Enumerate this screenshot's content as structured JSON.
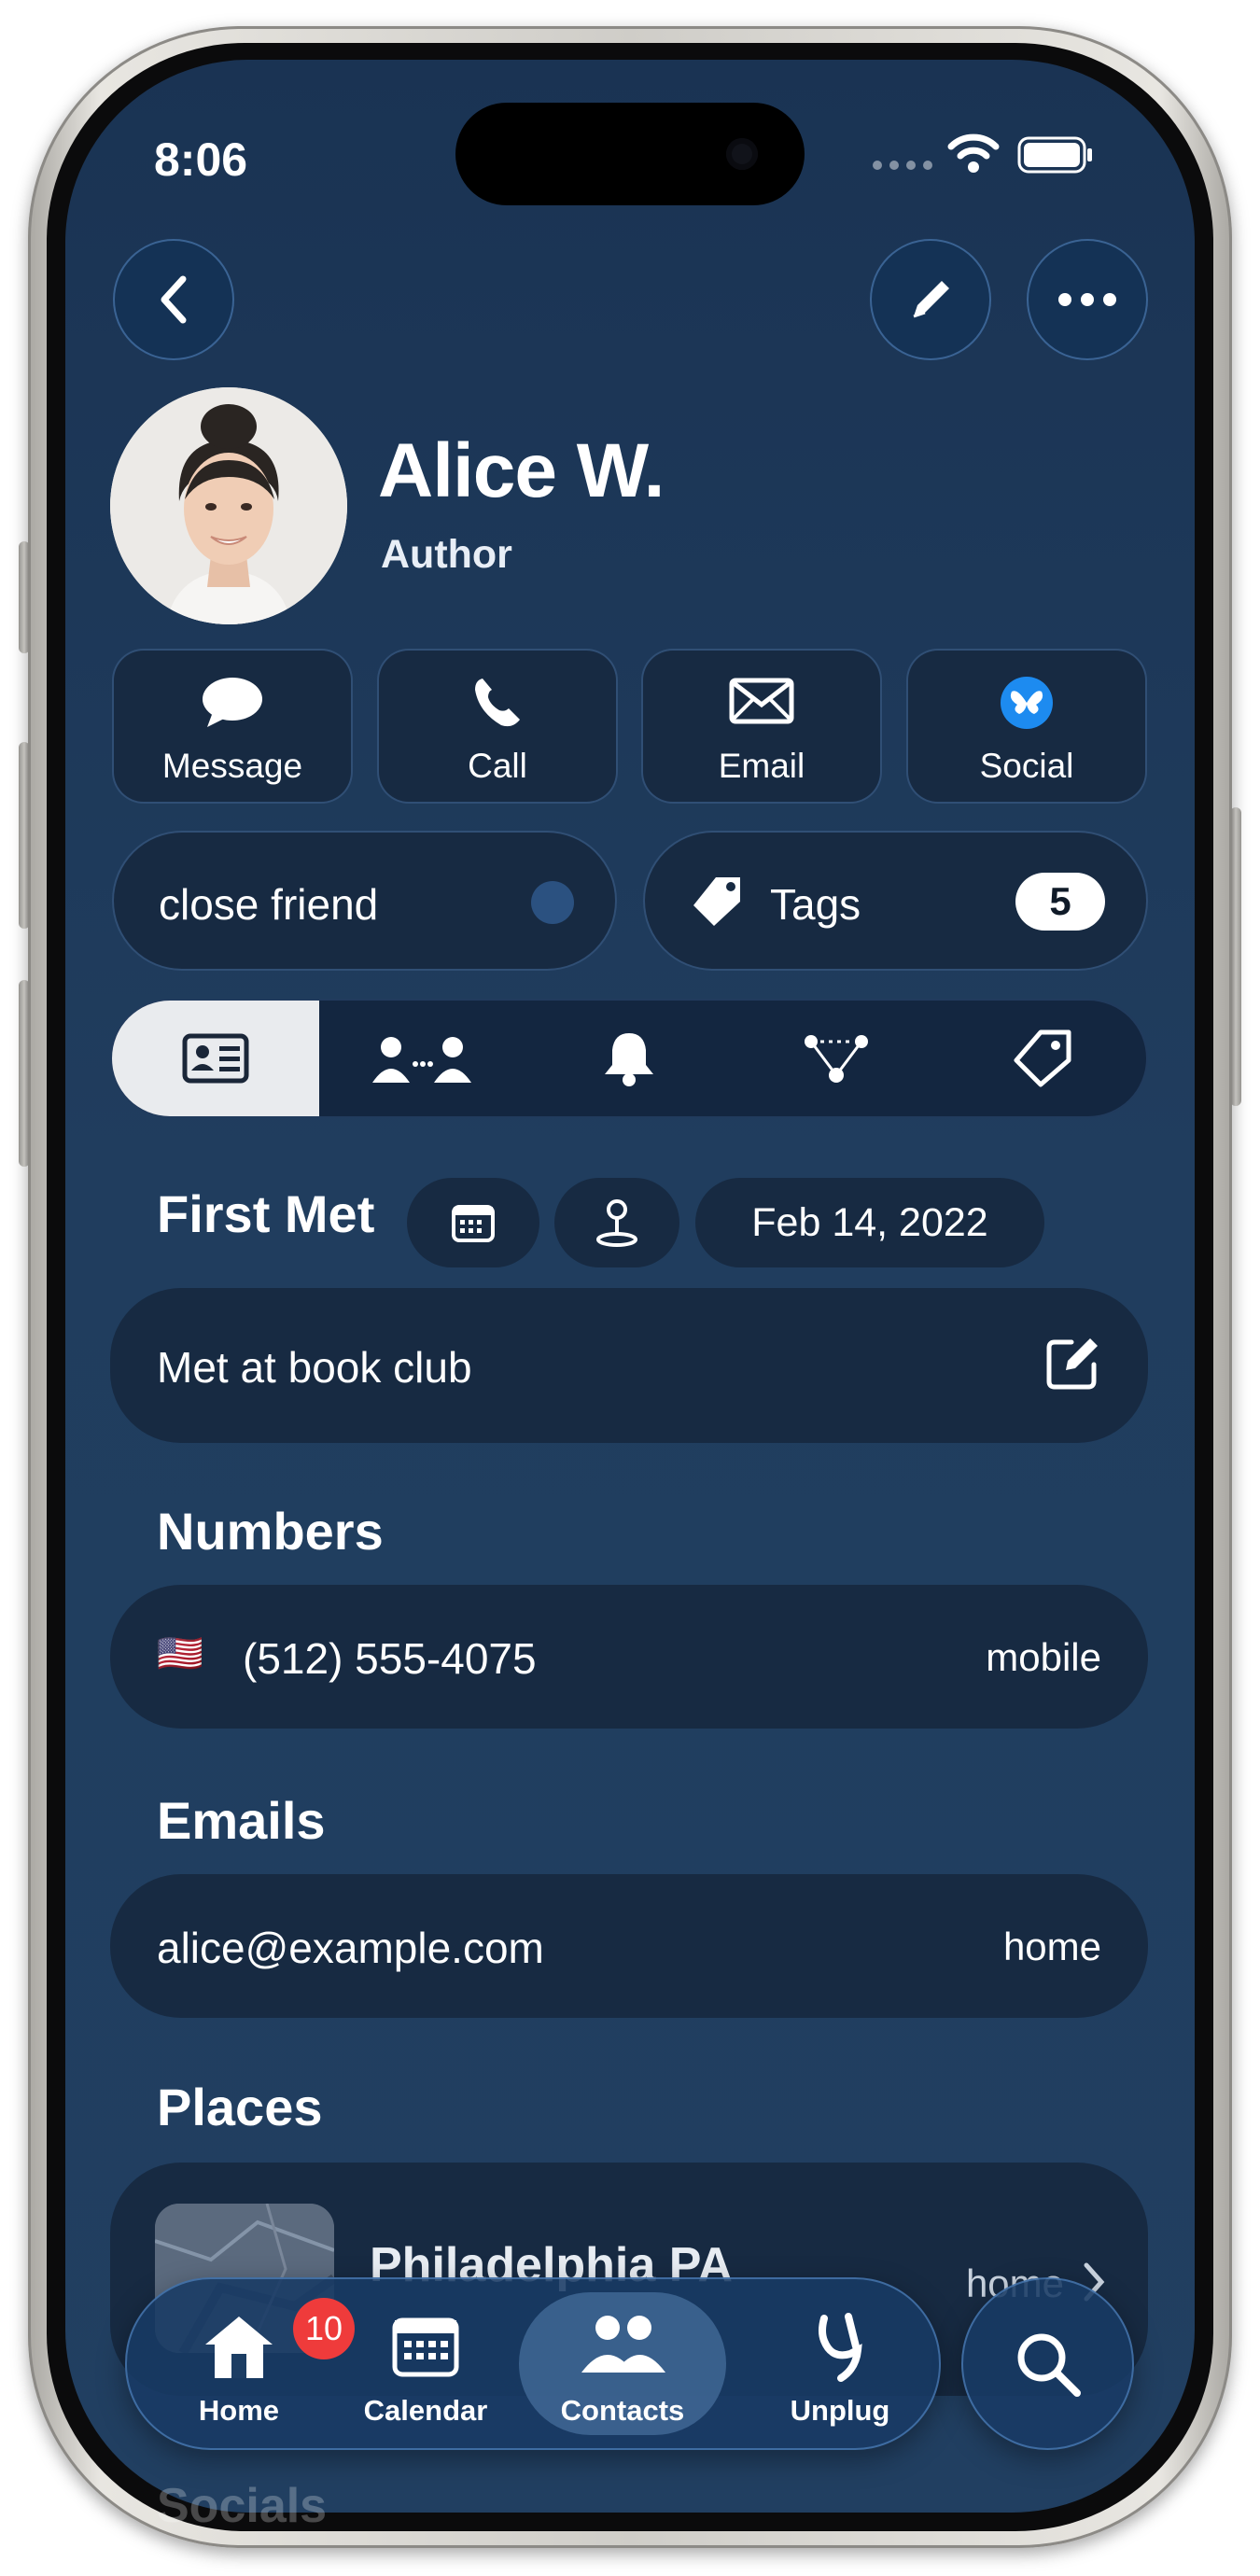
{
  "status_bar": {
    "time": "8:06",
    "wifi_icon": "wifi-icon",
    "battery_icon": "battery-icon"
  },
  "nav": {
    "back_icon": "chevron-left-icon",
    "edit_icon": "pencil-icon",
    "more_icon": "ellipsis-icon"
  },
  "profile": {
    "name": "Alice W.",
    "role": "Author"
  },
  "actions": [
    {
      "label": "Message",
      "icon": "message-bubble-icon"
    },
    {
      "label": "Call",
      "icon": "phone-icon"
    },
    {
      "label": "Email",
      "icon": "envelope-icon"
    },
    {
      "label": "Social",
      "icon": "butterfly-icon"
    }
  ],
  "group": {
    "label": "close friend",
    "dot_color": "#2b5180"
  },
  "tags": {
    "label": "Tags",
    "count": "5"
  },
  "segments": [
    {
      "icon": "contact-card-icon",
      "active": true
    },
    {
      "icon": "people-connection-icon",
      "active": false
    },
    {
      "icon": "bell-icon",
      "active": false
    },
    {
      "icon": "network-graph-icon",
      "active": false
    },
    {
      "icon": "tag-icon",
      "active": false
    }
  ],
  "first_met": {
    "title": "First Met",
    "calendar_icon": "calendar-icon",
    "location_icon": "map-pin-icon",
    "date": "Feb 14, 2022",
    "note": "Met at book club",
    "note_edit_icon": "edit-square-icon"
  },
  "numbers": {
    "title": "Numbers",
    "items": [
      {
        "flag": "🇺🇸",
        "value": "(512) 555-4075",
        "label": "mobile"
      }
    ]
  },
  "emails": {
    "title": "Emails",
    "items": [
      {
        "value": "alice@example.com",
        "label": "home"
      }
    ]
  },
  "places": {
    "title": "Places",
    "items": [
      {
        "name": "Philadelphia PA",
        "label": "home"
      }
    ]
  },
  "next_section": {
    "title": "Socials"
  },
  "tab_bar": {
    "tabs": [
      {
        "label": "Home",
        "icon": "house-icon",
        "badge": "10"
      },
      {
        "label": "Calendar",
        "icon": "calendar-grid-icon"
      },
      {
        "label": "Contacts",
        "icon": "people-icon",
        "active": true
      },
      {
        "label": "Unplug",
        "icon": "unplug-glyph-icon"
      }
    ],
    "search_icon": "magnifier-icon"
  },
  "colors": {
    "background": "#1e3a5c",
    "card": "#172a42",
    "accent": "#2b5180",
    "badge": "#ef3b3b",
    "social": "#1d8bf0"
  }
}
